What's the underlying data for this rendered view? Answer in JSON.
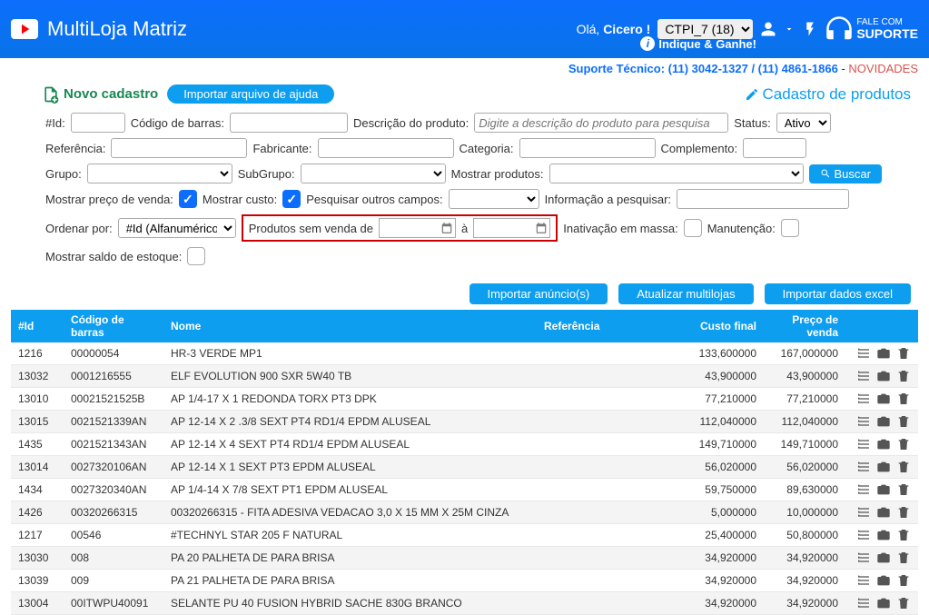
{
  "header": {
    "app_title": "MultiLoja Matriz",
    "greeting_prefix": "Olá, ",
    "greeting_user": "Cicero !",
    "store_selected": "CTPI_7 (18)",
    "indique": "Indique & Ganhe!",
    "support_small": "FALE COM",
    "support_big": "SUPORTE"
  },
  "subheader": {
    "label": "Suporte Técnico: ",
    "phone": "(11) 3042-1327 / (11) 4861-1866",
    "sep": " - ",
    "nov": "NOVIDADES"
  },
  "toolbar": {
    "novo": "Novo cadastro",
    "importar_ajuda": "Importar arquivo de ajuda",
    "cadastro_produtos": "Cadastro de produtos"
  },
  "filters": {
    "id": "#Id:",
    "codigo_barras": "Código de barras:",
    "descricao": "Descrição do produto:",
    "descricao_ph": "Digite a descrição do produto para pesquisa",
    "status": "Status:",
    "status_val": "Ativo",
    "referencia": "Referência:",
    "fabricante": "Fabricante:",
    "categoria": "Categoria:",
    "complemento": "Complemento:",
    "grupo": "Grupo:",
    "subgrupo": "SubGrupo:",
    "mostrar_produtos": "Mostrar produtos:",
    "buscar": "Buscar",
    "mostrar_preco": "Mostrar preço de venda:",
    "mostrar_custo": "Mostrar custo:",
    "outros_campos": "Pesquisar outros campos:",
    "info_pesquisar": "Informação a pesquisar:",
    "ordenar": "Ordenar por:",
    "ordenar_val": "#Id (Alfanumérico)",
    "sem_venda": "Produtos sem venda de",
    "a": "à",
    "inativacao": "Inativação em massa:",
    "manutencao": "Manutenção:",
    "saldo": "Mostrar saldo de estoque:"
  },
  "actions": {
    "importar_anuncios": "Importar anúncio(s)",
    "atualizar": "Atualizar multilojas",
    "importar_excel": "Importar dados excel"
  },
  "table": {
    "headers": {
      "id": "#Id",
      "codigo": "Código de barras",
      "nome": "Nome",
      "ref": "Referência",
      "custo": "Custo final",
      "preco": "Preço de venda"
    },
    "rows": [
      {
        "id": "1216",
        "codigo": "00000054",
        "nome": "HR-3 VERDE MP1",
        "ref": "",
        "custo": "133,600000",
        "preco": "167,000000"
      },
      {
        "id": "13032",
        "codigo": "0001216555",
        "nome": "ELF EVOLUTION 900 SXR 5W40 TB",
        "ref": "",
        "custo": "43,900000",
        "preco": "43,900000"
      },
      {
        "id": "13010",
        "codigo": "00021521525B",
        "nome": "AP 1/4-17 X 1 REDONDA TORX PT3 DPK",
        "ref": "",
        "custo": "77,210000",
        "preco": "77,210000"
      },
      {
        "id": "13015",
        "codigo": "0021521339AN",
        "nome": "AP 12-14 X 2 .3/8 SEXT PT4 RD1/4 EPDM ALUSEAL",
        "ref": "",
        "custo": "112,040000",
        "preco": "112,040000"
      },
      {
        "id": "1435",
        "codigo": "0021521343AN",
        "nome": "AP 12-14 X 4 SEXT PT4 RD1/4 EPDM ALUSEAL",
        "ref": "",
        "custo": "149,710000",
        "preco": "149,710000"
      },
      {
        "id": "13014",
        "codigo": "0027320106AN",
        "nome": "AP 12-14 X 1 SEXT PT3 EPDM ALUSEAL",
        "ref": "",
        "custo": "56,020000",
        "preco": "56,020000"
      },
      {
        "id": "1434",
        "codigo": "0027320340AN",
        "nome": "AP 1/4-14 X 7/8 SEXT PT1 EPDM ALUSEAL",
        "ref": "",
        "custo": "59,750000",
        "preco": "89,630000"
      },
      {
        "id": "1426",
        "codigo": "00320266315",
        "nome": "00320266315 - FITA ADESIVA VEDACAO 3,0 X 15 MM X 25M CINZA",
        "ref": "",
        "custo": "5,000000",
        "preco": "10,000000"
      },
      {
        "id": "1217",
        "codigo": "00546",
        "nome": "#TECHNYL STAR 205 F NATURAL",
        "ref": "",
        "custo": "25,400000",
        "preco": "50,800000"
      },
      {
        "id": "13030",
        "codigo": "008",
        "nome": "PA 20 PALHETA DE PARA BRISA",
        "ref": "",
        "custo": "34,920000",
        "preco": "34,920000"
      },
      {
        "id": "13039",
        "codigo": "009",
        "nome": "PA 21 PALHETA DE PARA BRISA",
        "ref": "",
        "custo": "34,920000",
        "preco": "34,920000"
      },
      {
        "id": "13004",
        "codigo": "00ITWPU40091",
        "nome": "SELANTE PU 40 FUSION HYBRID SACHE 830G BRANCO",
        "ref": "",
        "custo": "34,920000",
        "preco": "34,920000"
      }
    ]
  }
}
